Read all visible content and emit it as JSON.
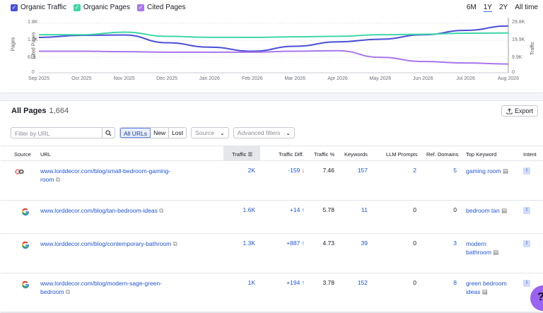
{
  "legend": [
    {
      "label": "Organic Traffic",
      "color": "#4c4fd6"
    },
    {
      "label": "Organic Pages",
      "color": "#3fd6a8"
    },
    {
      "label": "Cited Pages",
      "color": "#a876ec"
    }
  ],
  "ranges": [
    "6M",
    "1Y",
    "2Y",
    "All time"
  ],
  "active_range": "1Y",
  "chart_data": {
    "type": "line",
    "x": [
      "Sep 2025",
      "Oct 2025",
      "Nov 2025",
      "Dec 2025",
      "Jan 2026",
      "Feb 2026",
      "Mar 2026",
      "Apr 2026",
      "May 2026",
      "Jun 2026",
      "Jul 2026",
      "Aug 2026"
    ],
    "left_axis_labels": [
      "Pages",
      "Cited Pages"
    ],
    "left_ticks": [
      "1.8K",
      "1.2K",
      "618",
      "0"
    ],
    "right_axis_label": "Traffic",
    "right_ticks": [
      "29.8K",
      "19.9K",
      "9.9K",
      "0"
    ],
    "series": [
      {
        "name": "Organic Traffic",
        "axis": "right",
        "values": [
          20000,
          21200,
          21400,
          17000,
          14500,
          12200,
          15000,
          17500,
          19000,
          21500,
          24000,
          26500
        ]
      },
      {
        "name": "Organic Pages",
        "axis": "left",
        "values": [
          1.48,
          1.48,
          1.58,
          1.42,
          1.38,
          1.38,
          1.4,
          1.42,
          1.48,
          1.5,
          1.54,
          1.55
        ]
      },
      {
        "name": "Cited Pages",
        "axis": "left",
        "values": [
          0.84,
          0.84,
          0.82,
          0.8,
          0.8,
          0.8,
          0.84,
          0.86,
          0.6,
          0.44,
          0.38,
          0.34
        ]
      }
    ]
  },
  "table": {
    "title": "All Pages",
    "count": "1,664",
    "export_label": "Export",
    "search_placeholder": "Filter by URL",
    "segments": [
      "All URLs",
      "New",
      "Lost"
    ],
    "source_dropdown": "Source",
    "advanced_filters": "Advanced filters",
    "columns": [
      "Source",
      "URL",
      "Traffic",
      "Traffic Diff.",
      "Traffic %",
      "Keywords",
      "LLM Prompts",
      "Ref. Domains",
      "Top Keyword",
      "Intent"
    ],
    "rows": [
      {
        "source": "google+chatgpt",
        "url": "www.lorddecor.com/blog/small-bedroom-gaming-room",
        "traffic": "2K",
        "diff": "-159",
        "diff_dir": "down",
        "pct": "7.46",
        "keywords": "157",
        "llm": "2",
        "ref": "5",
        "top_keyword": "gaming room",
        "intent": "I"
      },
      {
        "source": "google",
        "url": "www.lorddecor.com/blog/tan-bedroom-ideas",
        "traffic": "1.6K",
        "diff": "+14",
        "diff_dir": "up",
        "pct": "5.78",
        "keywords": "11",
        "llm": "0",
        "ref": "0",
        "top_keyword": "bedroom tan",
        "intent": "I"
      },
      {
        "source": "google",
        "url": "www.lorddecor.com/blog/contemporary-bathroom",
        "traffic": "1.3K",
        "diff": "+887",
        "diff_dir": "up",
        "pct": "4.73",
        "keywords": "39",
        "llm": "0",
        "ref": "3",
        "top_keyword": "modern bathroom",
        "intent": "I"
      },
      {
        "source": "google",
        "url": "www.lorddecor.com/blog/modern-sage-green-bedroom",
        "traffic": "1K",
        "diff": "+194",
        "diff_dir": "up",
        "pct": "3.78",
        "keywords": "152",
        "llm": "0",
        "ref": "8",
        "top_keyword": "green bedroom ideas",
        "intent": "I"
      }
    ]
  },
  "help_label": "?"
}
